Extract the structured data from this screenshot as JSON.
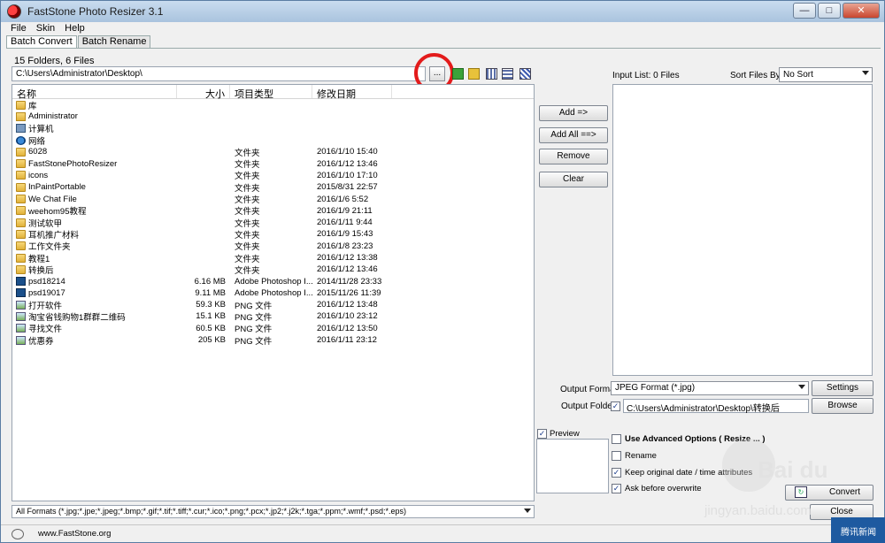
{
  "window": {
    "title": "FastStone Photo Resizer 3.1",
    "min": "—",
    "max": "□",
    "close": "✕"
  },
  "menu": [
    "File",
    "Skin",
    "Help"
  ],
  "tabs": [
    "Batch Convert",
    "Batch Rename"
  ],
  "left": {
    "folder_count": "15 Folders, 6 Files",
    "path": "C:\\Users\\Administrator\\Desktop\\",
    "browse_label": "...",
    "columns": [
      "名称",
      "大小",
      "项目类型",
      "修改日期"
    ],
    "rows": [
      {
        "icon": "folder",
        "name": "库",
        "size": "",
        "type": "",
        "date": ""
      },
      {
        "icon": "user",
        "name": "Administrator",
        "size": "",
        "type": "",
        "date": ""
      },
      {
        "icon": "pc",
        "name": "计算机",
        "size": "",
        "type": "",
        "date": ""
      },
      {
        "icon": "net",
        "name": "网络",
        "size": "",
        "type": "",
        "date": ""
      },
      {
        "icon": "folder",
        "name": "6028",
        "size": "",
        "type": "文件夹",
        "date": "2016/1/10 15:40"
      },
      {
        "icon": "folder",
        "name": "FastStonePhotoResizer",
        "size": "",
        "type": "文件夹",
        "date": "2016/1/12 13:46"
      },
      {
        "icon": "folder",
        "name": "icons",
        "size": "",
        "type": "文件夹",
        "date": "2016/1/10 17:10"
      },
      {
        "icon": "folder",
        "name": "InPaintPortable",
        "size": "",
        "type": "文件夹",
        "date": "2015/8/31 22:57"
      },
      {
        "icon": "folder",
        "name": "We Chat File",
        "size": "",
        "type": "文件夹",
        "date": "2016/1/6 5:52"
      },
      {
        "icon": "folder",
        "name": "weehom95教程",
        "size": "",
        "type": "文件夹",
        "date": "2016/1/9 21:11"
      },
      {
        "icon": "folder",
        "name": "测试软甲",
        "size": "",
        "type": "文件夹",
        "date": "2016/1/11 9:44"
      },
      {
        "icon": "folder",
        "name": "耳机推广材料",
        "size": "",
        "type": "文件夹",
        "date": "2016/1/9 15:43"
      },
      {
        "icon": "folder",
        "name": "工作文件夹",
        "size": "",
        "type": "文件夹",
        "date": "2016/1/8 23:23"
      },
      {
        "icon": "folder",
        "name": "教程1",
        "size": "",
        "type": "文件夹",
        "date": "2016/1/12 13:38"
      },
      {
        "icon": "folder",
        "name": "转换后",
        "size": "",
        "type": "文件夹",
        "date": "2016/1/12 13:46"
      },
      {
        "icon": "psd",
        "name": "psd18214",
        "size": "6.16 MB",
        "type": "Adobe Photoshop I...",
        "date": "2014/11/28 23:33"
      },
      {
        "icon": "psd",
        "name": "psd19017",
        "size": "9.11 MB",
        "type": "Adobe Photoshop I...",
        "date": "2015/11/26 11:39"
      },
      {
        "icon": "png",
        "name": "打开软件",
        "size": "59.3 KB",
        "type": "PNG 文件",
        "date": "2016/1/12 13:48"
      },
      {
        "icon": "png",
        "name": "淘宝省钱购物1群群二维码",
        "size": "15.1 KB",
        "type": "PNG 文件",
        "date": "2016/1/10 23:12"
      },
      {
        "icon": "png",
        "name": "寻找文件",
        "size": "60.5 KB",
        "type": "PNG 文件",
        "date": "2016/1/12 13:50"
      },
      {
        "icon": "png",
        "name": "优惠券",
        "size": "205 KB",
        "type": "PNG 文件",
        "date": "2016/1/11 23:12"
      }
    ],
    "format_filter": "All Formats (*.jpg;*.jpe;*.jpeg;*.bmp;*.gif;*.tif;*.tiff;*.cur;*.ico;*.png;*.pcx;*.jp2;*.j2k;*.tga;*.ppm;*.wmf;*.psd;*.eps)"
  },
  "actions": {
    "add": "Add =>",
    "add_all": "Add All ==>",
    "remove": "Remove",
    "clear": "Clear"
  },
  "right": {
    "input_list": "Input List:  0 Files",
    "sort_label": "Sort Files By:",
    "sort_value": "No Sort",
    "output_format_label": "Output Format:",
    "output_format_value": "JPEG Format (*.jpg)",
    "settings": "Settings",
    "output_folder_label": "Output Folder:",
    "output_folder_value": "C:\\Users\\Administrator\\Desktop\\转换后",
    "browse": "Browse",
    "preview": "Preview",
    "use_advanced": "Use Advanced Options ( Resize ... )",
    "rename": "Rename",
    "keep_date": "Keep original date / time attributes",
    "ask_overwrite": "Ask before overwrite",
    "convert": "Convert",
    "close": "Close"
  },
  "status": {
    "url": "www.FastStone.org"
  },
  "overlay": {
    "watermark_main": "Bai du",
    "watermark_sub": "jingyan.baidu.com",
    "news": "腾讯新闻"
  },
  "colors": {
    "highlight_circle": "#e31b1b",
    "title_gradient_top": "#c9dcef",
    "news_badge": "#1e5aa0"
  }
}
